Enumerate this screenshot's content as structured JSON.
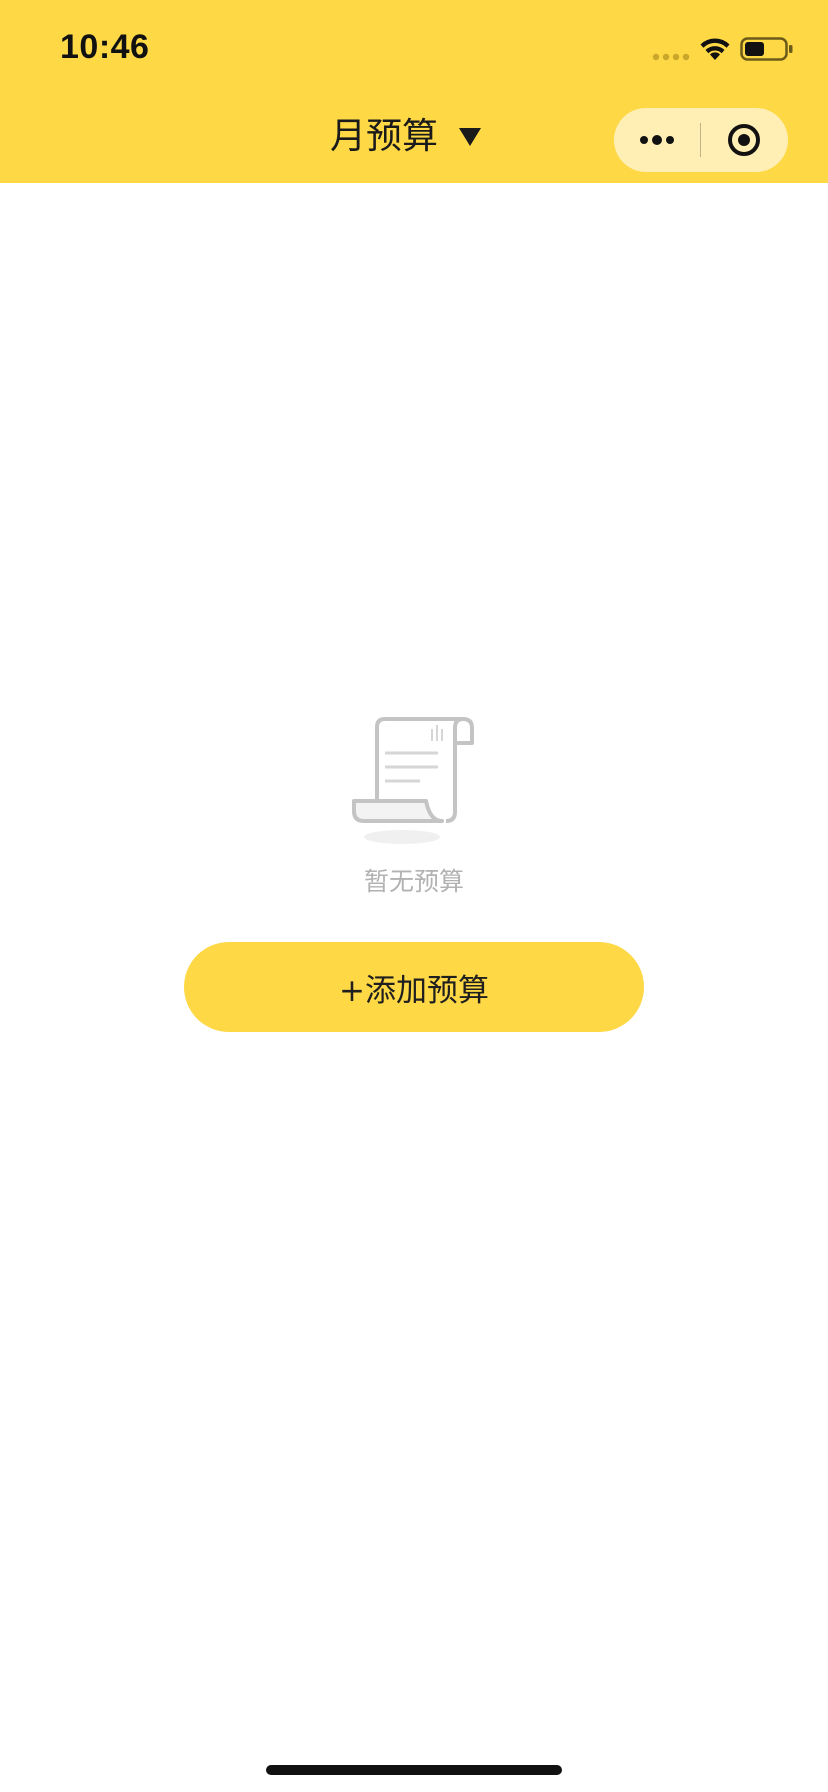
{
  "status_bar": {
    "time": "10:46",
    "signal_icon": "cellular-signal-icon",
    "wifi_icon": "wifi-icon",
    "battery_icon": "battery-icon",
    "battery_level": 0.5
  },
  "header": {
    "title": "月预算",
    "dropdown_icon": "caret-down-icon",
    "background_color": "#FED845"
  },
  "capsule": {
    "more_icon": "more-dots-icon",
    "close_icon": "target-circle-icon"
  },
  "empty_state": {
    "icon": "empty-scroll-icon",
    "message": "暂无预算"
  },
  "actions": {
    "add_budget_label": "+添加预算",
    "accent_color": "#FED845"
  }
}
